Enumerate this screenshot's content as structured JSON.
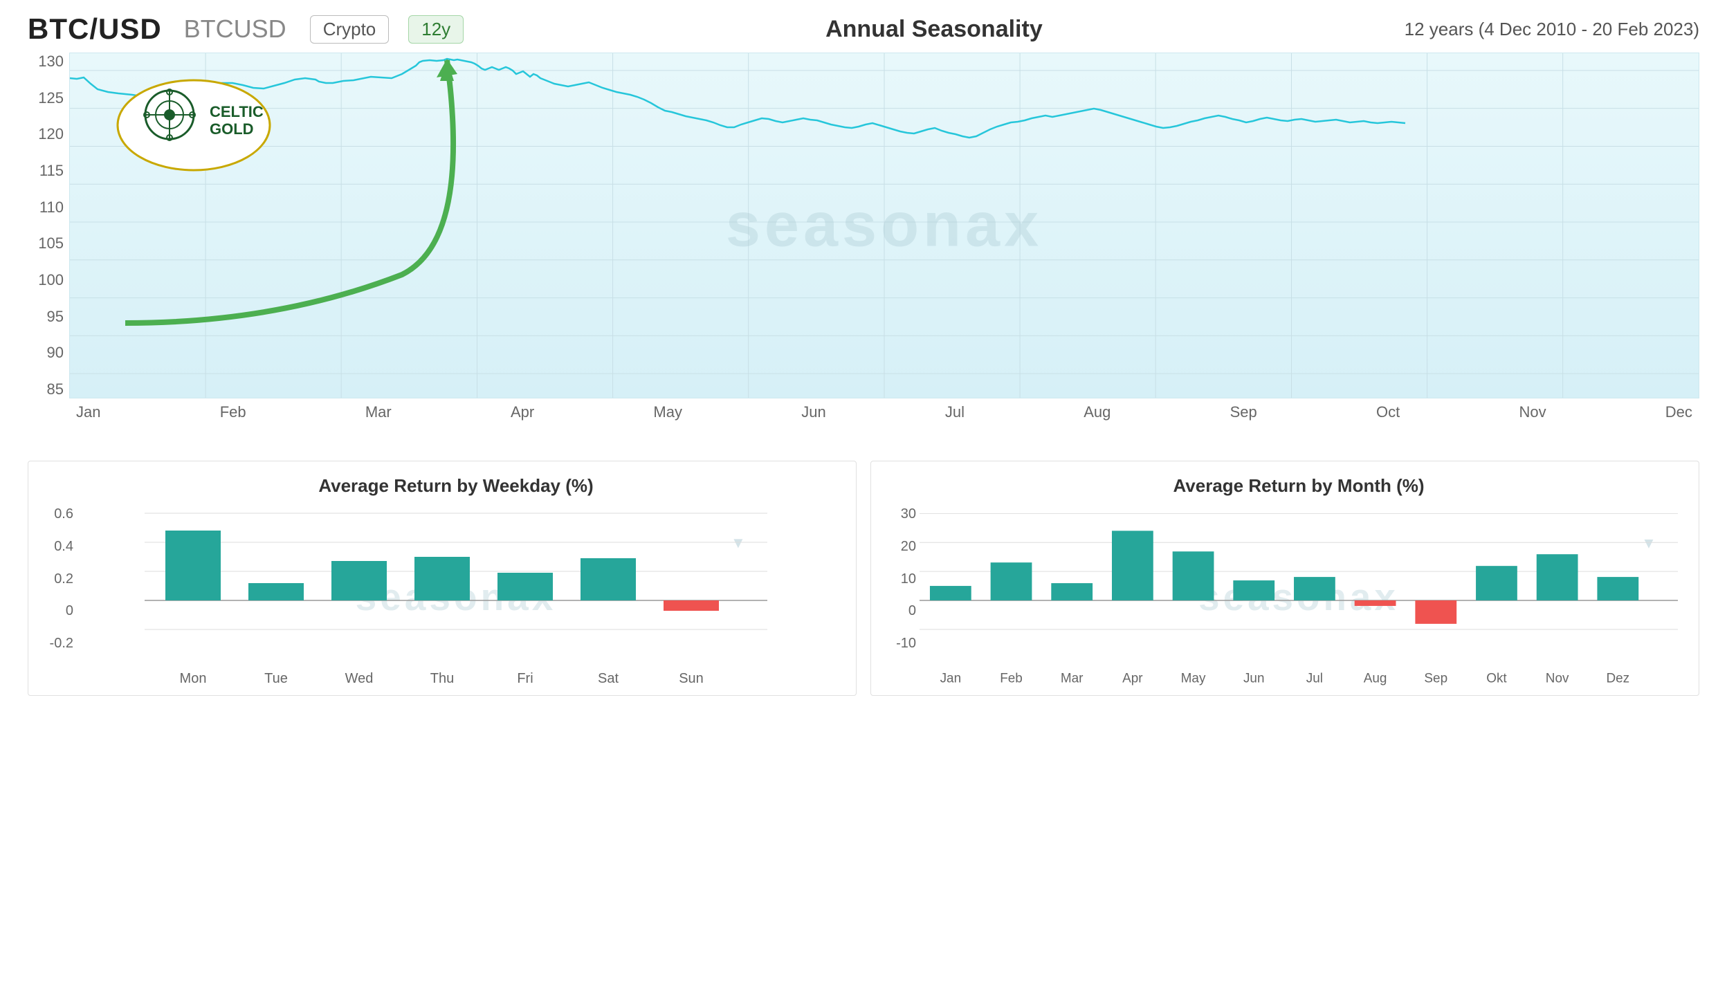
{
  "header": {
    "symbol": "BTC/USD",
    "subsymbol": "BTCUSD",
    "badge_crypto": "Crypto",
    "badge_period": "12y",
    "chart_title": "Annual Seasonality",
    "date_range": "12 years (4 Dec 2010 - 20 Feb 2023)"
  },
  "main_chart": {
    "y_labels": [
      "130",
      "125",
      "120",
      "115",
      "110",
      "105",
      "100",
      "95",
      "90",
      "85"
    ],
    "x_labels": [
      "Jan",
      "Feb",
      "Mar",
      "Apr",
      "May",
      "Jun",
      "Jul",
      "Aug",
      "Sep",
      "Oct",
      "Nov",
      "Dec"
    ],
    "watermark": "seasonax"
  },
  "weekday_chart": {
    "title": "Average Return by Weekday (%)",
    "y_labels": [
      "0.6",
      "0.4",
      "0.2",
      "0",
      "-0.2"
    ],
    "bars": [
      {
        "label": "Mon",
        "value": 0.48,
        "negative": false
      },
      {
        "label": "Tue",
        "value": 0.12,
        "negative": false
      },
      {
        "label": "Wed",
        "value": 0.27,
        "negative": false
      },
      {
        "label": "Thu",
        "value": 0.3,
        "negative": false
      },
      {
        "label": "Fri",
        "value": 0.19,
        "negative": false
      },
      {
        "label": "Sat",
        "value": 0.29,
        "negative": false
      },
      {
        "label": "Sun",
        "value": -0.07,
        "negative": true
      }
    ],
    "watermark": "seasonax"
  },
  "monthly_chart": {
    "title": "Average Return by Month (%)",
    "y_labels": [
      "30",
      "20",
      "10",
      "0",
      "-10"
    ],
    "bars": [
      {
        "label": "Jan",
        "value": 5,
        "negative": false
      },
      {
        "label": "Feb",
        "value": 13,
        "negative": false
      },
      {
        "label": "Mar",
        "value": 6,
        "negative": false
      },
      {
        "label": "Apr",
        "value": 24,
        "negative": false
      },
      {
        "label": "May",
        "value": 17,
        "negative": false
      },
      {
        "label": "Jun",
        "value": 7,
        "negative": false
      },
      {
        "label": "Jul",
        "value": 8,
        "negative": false
      },
      {
        "label": "Aug",
        "value": -2,
        "negative": true
      },
      {
        "label": "Sep",
        "value": -8,
        "negative": true
      },
      {
        "label": "Okt",
        "value": 12,
        "negative": false
      },
      {
        "label": "Nov",
        "value": 16,
        "negative": false
      },
      {
        "label": "Dez",
        "value": 8,
        "negative": false
      }
    ],
    "watermark": "seasonax"
  }
}
